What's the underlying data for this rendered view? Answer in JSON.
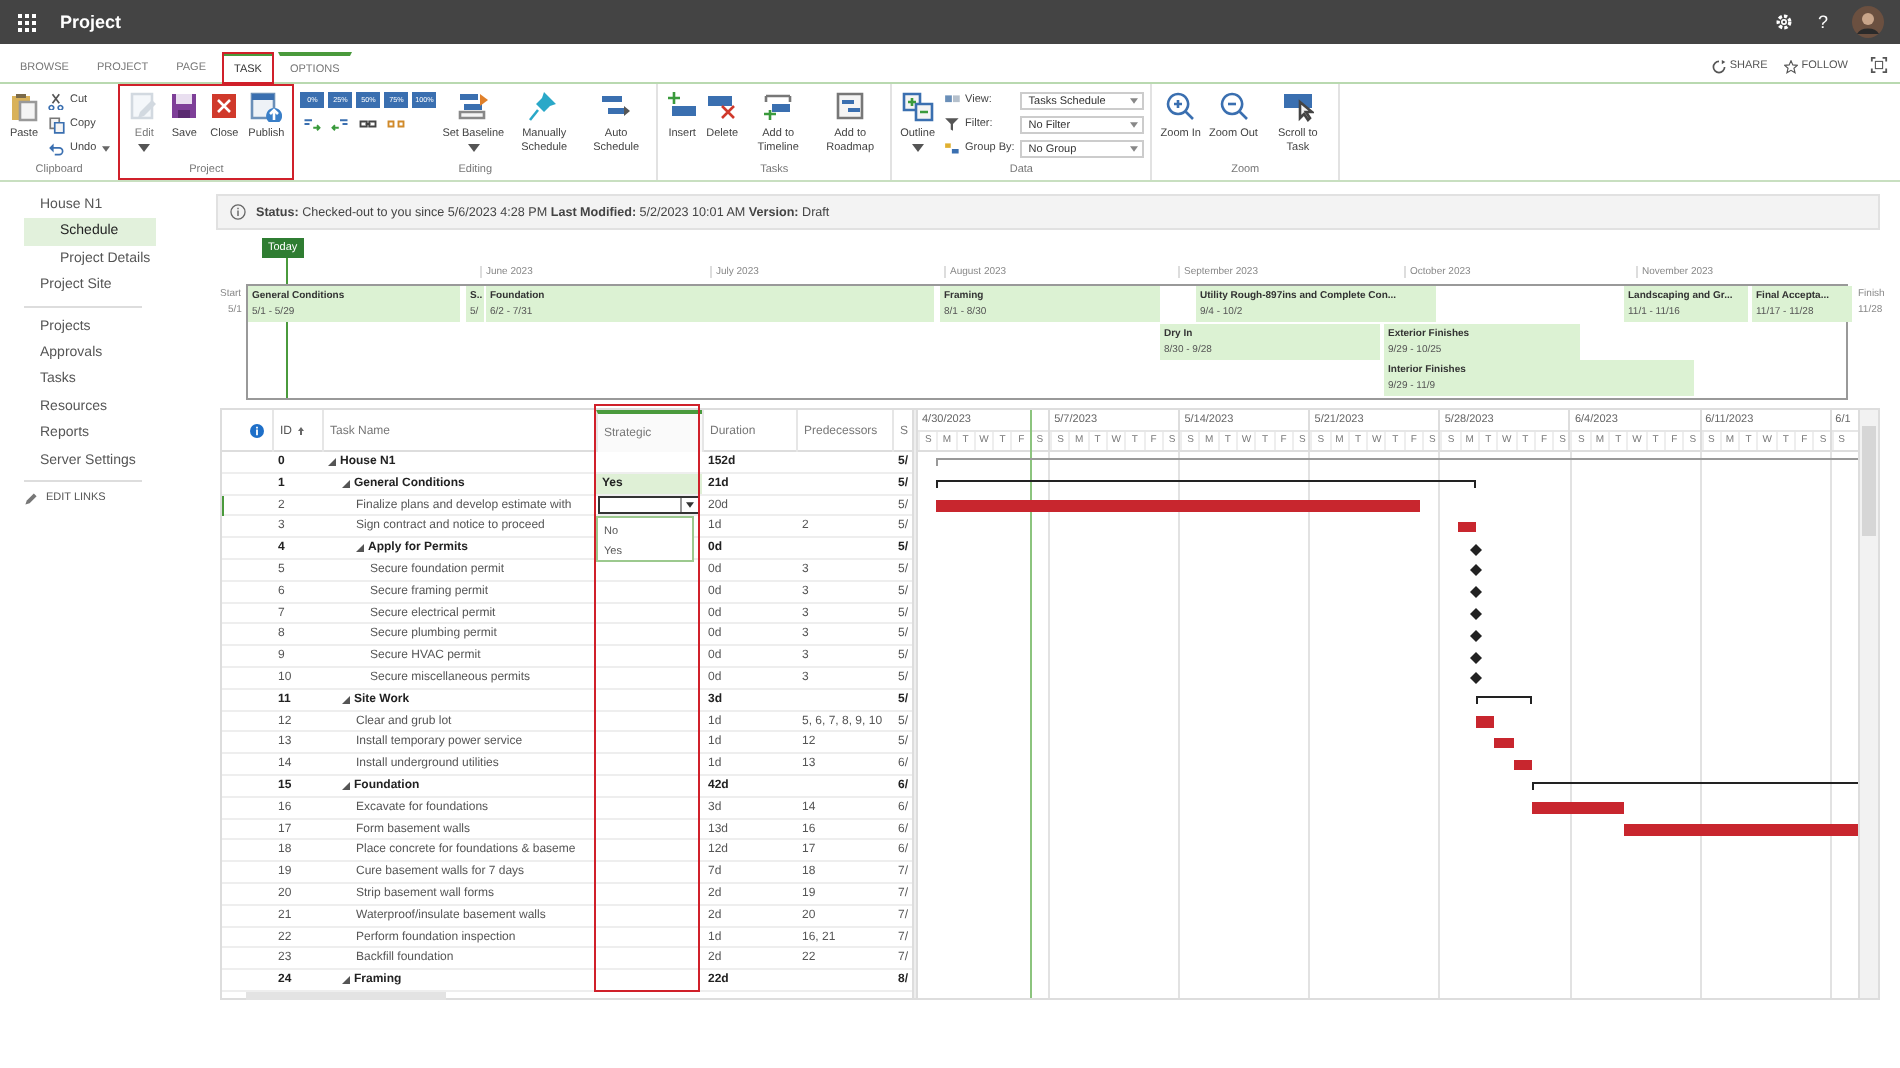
{
  "app": {
    "title": "Project",
    "help": "?"
  },
  "tabs": [
    {
      "label": "BROWSE",
      "selected": false,
      "highlighted": false,
      "contextual": false
    },
    {
      "label": "PROJECT",
      "selected": false,
      "highlighted": false,
      "contextual": false
    },
    {
      "label": "PAGE",
      "selected": false,
      "highlighted": false,
      "contextual": false
    },
    {
      "label": "TASK",
      "selected": true,
      "highlighted": true,
      "contextual": true
    },
    {
      "label": "OPTIONS",
      "selected": false,
      "highlighted": false,
      "contextual": true
    }
  ],
  "header_actions": [
    {
      "label": "SHARE"
    },
    {
      "label": "FOLLOW"
    }
  ],
  "ribbon": [
    {
      "label": "Clipboard",
      "highlighted": false,
      "buttons": [
        {
          "label": "Paste",
          "kind": "large",
          "disabled": false,
          "dropdown": false
        },
        {
          "label": "Cut",
          "kind": "small",
          "disabled": false,
          "dropdown": false
        },
        {
          "label": "Copy",
          "kind": "small",
          "disabled": false,
          "dropdown": false
        },
        {
          "label": "Undo",
          "kind": "small",
          "disabled": false,
          "dropdown": true
        }
      ]
    },
    {
      "label": "Project",
      "highlighted": true,
      "buttons": [
        {
          "label": "Edit",
          "kind": "large",
          "disabled": true,
          "dropdown": true
        },
        {
          "label": "Save",
          "kind": "large",
          "disabled": false,
          "dropdown": false
        },
        {
          "label": "Close",
          "kind": "large",
          "disabled": false,
          "dropdown": false
        },
        {
          "label": "Publish",
          "kind": "large",
          "disabled": false,
          "dropdown": false
        }
      ]
    },
    {
      "label": "Editing",
      "highlighted": false,
      "buttons": [
        {
          "label": "0%",
          "kind": "progress",
          "disabled": false,
          "dropdown": false
        },
        {
          "label": "25%",
          "kind": "progress",
          "disabled": false,
          "dropdown": false
        },
        {
          "label": "50%",
          "kind": "progress",
          "disabled": false,
          "dropdown": false
        },
        {
          "label": "75%",
          "kind": "progress",
          "disabled": false,
          "dropdown": false
        },
        {
          "label": "100%",
          "kind": "progress",
          "disabled": false,
          "dropdown": false
        },
        {
          "kind": "icon",
          "disabled": false,
          "dropdown": false
        },
        {
          "kind": "icon",
          "disabled": false,
          "dropdown": false
        },
        {
          "kind": "icon",
          "disabled": false,
          "dropdown": false
        },
        {
          "kind": "icon",
          "disabled": false,
          "dropdown": false
        },
        {
          "label": "Set Baseline",
          "kind": "large",
          "disabled": false,
          "dropdown": true
        },
        {
          "label": "Manually Schedule",
          "kind": "large",
          "disabled": false,
          "dropdown": false
        },
        {
          "label": "Auto Schedule",
          "kind": "large",
          "disabled": false,
          "dropdown": false
        }
      ]
    },
    {
      "label": "Tasks",
      "highlighted": false,
      "buttons": [
        {
          "label": "Insert",
          "kind": "large",
          "disabled": false,
          "dropdown": false
        },
        {
          "label": "Delete",
          "kind": "large",
          "disabled": false,
          "dropdown": false
        },
        {
          "label": "Add to Timeline",
          "kind": "large",
          "disabled": false,
          "dropdown": false
        },
        {
          "label": "Add to Roadmap",
          "kind": "large",
          "disabled": false,
          "dropdown": false
        }
      ]
    },
    {
      "label": "Data",
      "highlighted": false,
      "buttons": [
        {
          "label": "Outline",
          "kind": "large",
          "disabled": false,
          "dropdown": true
        },
        {
          "label": "View:",
          "kind": "small",
          "disabled": false,
          "dropdown": false
        },
        {
          "label": "Filter:",
          "kind": "small",
          "disabled": false,
          "dropdown": false
        },
        {
          "label": "Group By:",
          "kind": "small",
          "disabled": false,
          "dropdown": false
        },
        {
          "label": "Tasks Schedule",
          "kind": "select",
          "disabled": false,
          "dropdown": true
        },
        {
          "label": "No Filter",
          "kind": "select",
          "disabled": false,
          "dropdown": true
        },
        {
          "label": "No Group",
          "kind": "select",
          "disabled": false,
          "dropdown": true
        }
      ]
    },
    {
      "label": "Zoom",
      "highlighted": false,
      "buttons": [
        {
          "label": "Zoom In",
          "kind": "large",
          "disabled": false,
          "dropdown": false
        },
        {
          "label": "Zoom Out",
          "kind": "large",
          "disabled": false,
          "dropdown": false
        },
        {
          "label": "Scroll to Task",
          "kind": "large",
          "disabled": false,
          "dropdown": false
        }
      ]
    }
  ],
  "nav": {
    "items": [
      {
        "label": "House N1",
        "selected": false,
        "children": [
          {
            "label": "Schedule",
            "selected": true
          },
          {
            "label": "Project Details",
            "selected": false
          }
        ]
      },
      {
        "label": "Project Site",
        "selected": false
      }
    ],
    "links": [
      {
        "label": "Projects"
      },
      {
        "label": "Approvals"
      },
      {
        "label": "Tasks"
      },
      {
        "label": "Resources"
      },
      {
        "label": "Reports"
      },
      {
        "label": "Server Settings"
      }
    ],
    "edit_links": "EDIT LINKS"
  },
  "status": "**Status:** Checked-out to you since 5/6/2023 4:28 PM **Last Modified:** 5/2/2023 10:01 AM **Version:** Draft",
  "timeline": {
    "today": "Today",
    "start_label": "Start",
    "start_date": "5/1",
    "finish_label": "Finish",
    "finish_date": "11/28",
    "months": [
      "June 2023",
      "July 2023",
      "August 2023",
      "September 2023",
      "October 2023",
      "November 2023"
    ],
    "bars": [
      {
        "name": "General Conditions",
        "dates": "5/1 - 5/29"
      },
      {
        "name": "S..",
        "dates": "5/"
      },
      {
        "name": "Foundation",
        "dates": "6/2 - 7/31"
      },
      {
        "name": "Framing",
        "dates": "8/1 - 8/30"
      },
      {
        "name": "Utility Rough-897ins and Complete Con...",
        "dates": "9/4 - 10/2"
      },
      {
        "name": "Landscaping and Gr...",
        "dates": "11/1 - 11/16"
      },
      {
        "name": "Final Accepta...",
        "dates": "11/17 - 11/28"
      },
      {
        "name": "Dry In",
        "dates": "8/30 - 9/28"
      },
      {
        "name": "Exterior Finishes",
        "dates": "9/29 - 10/25"
      },
      {
        "name": "Interior Finishes",
        "dates": "9/29 - 11/9"
      }
    ]
  },
  "grid": {
    "columns": [
      {
        "label": "ID",
        "sorted": true,
        "selected": false,
        "highlighted": false
      },
      {
        "label": "Task Name",
        "sorted": false,
        "selected": false,
        "highlighted": false
      },
      {
        "label": "Strategic",
        "sorted": false,
        "selected": true,
        "highlighted": true
      },
      {
        "label": "Duration",
        "sorted": false,
        "selected": false,
        "highlighted": false
      },
      {
        "label": "Predecessors",
        "sorted": false,
        "selected": false,
        "highlighted": false
      },
      {
        "label": "S",
        "sorted": false,
        "selected": false,
        "highlighted": false
      }
    ],
    "dropdown_options": [
      {
        "label": "No",
        "selected": false
      },
      {
        "label": "Yes",
        "selected": false
      }
    ],
    "rows": [
      {
        "id": "0",
        "name": "House N1",
        "kind": "summary",
        "expanded": true,
        "selected": false,
        "editing": false,
        "duration": "152d",
        "start": "5/",
        "children": [
          {
            "id": "1",
            "name": "General Conditions",
            "kind": "summary",
            "expanded": true,
            "selected": true,
            "editing": false,
            "strategic": "Yes",
            "duration": "21d",
            "start": "5/",
            "children": [
              {
                "id": "2",
                "name": "Finalize plans and develop estimate with",
                "kind": "task",
                "expanded": false,
                "selected": false,
                "editing": true,
                "duration": "20d",
                "start": "5/"
              },
              {
                "id": "3",
                "name": "Sign contract and notice to proceed",
                "kind": "task",
                "expanded": false,
                "selected": false,
                "editing": false,
                "duration": "1d",
                "predecessors": "2",
                "start": "5/"
              },
              {
                "id": "4",
                "name": "Apply for Permits",
                "kind": "summary",
                "expanded": true,
                "selected": false,
                "editing": false,
                "duration": "0d",
                "start": "5/",
                "children": [
                  {
                    "id": "5",
                    "name": "Secure foundation permit",
                    "kind": "milestone",
                    "expanded": false,
                    "selected": false,
                    "editing": false,
                    "duration": "0d",
                    "predecessors": "3",
                    "start": "5/"
                  },
                  {
                    "id": "6",
                    "name": "Secure framing permit",
                    "kind": "milestone",
                    "expanded": false,
                    "selected": false,
                    "editing": false,
                    "duration": "0d",
                    "predecessors": "3",
                    "start": "5/"
                  },
                  {
                    "id": "7",
                    "name": "Secure electrical permit",
                    "kind": "milestone",
                    "expanded": false,
                    "selected": false,
                    "editing": false,
                    "duration": "0d",
                    "predecessors": "3",
                    "start": "5/"
                  },
                  {
                    "id": "8",
                    "name": "Secure plumbing permit",
                    "kind": "milestone",
                    "expanded": false,
                    "selected": false,
                    "editing": false,
                    "duration": "0d",
                    "predecessors": "3",
                    "start": "5/"
                  },
                  {
                    "id": "9",
                    "name": "Secure HVAC permit",
                    "kind": "milestone",
                    "expanded": false,
                    "selected": false,
                    "editing": false,
                    "duration": "0d",
                    "predecessors": "3",
                    "start": "5/"
                  },
                  {
                    "id": "10",
                    "name": "Secure miscellaneous permits",
                    "kind": "milestone",
                    "expanded": false,
                    "selected": false,
                    "editing": false,
                    "duration": "0d",
                    "predecessors": "3",
                    "start": "5/"
                  }
                ]
              }
            ]
          },
          {
            "id": "11",
            "name": "Site Work",
            "kind": "summary",
            "expanded": true,
            "selected": false,
            "editing": false,
            "duration": "3d",
            "start": "5/",
            "children": [
              {
                "id": "12",
                "name": "Clear and grub lot",
                "kind": "task",
                "expanded": false,
                "selected": false,
                "editing": false,
                "duration": "1d",
                "predecessors": "5, 6, 7, 8, 9, 10",
                "start": "5/"
              },
              {
                "id": "13",
                "name": "Install temporary power service",
                "kind": "task",
                "expanded": false,
                "selected": false,
                "editing": false,
                "duration": "1d",
                "predecessors": "12",
                "start": "5/"
              },
              {
                "id": "14",
                "name": "Install underground utilities",
                "kind": "task",
                "expanded": false,
                "selected": false,
                "editing": false,
                "duration": "1d",
                "predecessors": "13",
                "start": "6/"
              }
            ]
          },
          {
            "id": "15",
            "name": "Foundation",
            "kind": "summary",
            "expanded": true,
            "selected": false,
            "editing": false,
            "duration": "42d",
            "start": "6/",
            "children": [
              {
                "id": "16",
                "name": "Excavate for foundations",
                "kind": "task",
                "expanded": false,
                "selected": false,
                "editing": false,
                "duration": "3d",
                "predecessors": "14",
                "start": "6/"
              },
              {
                "id": "17",
                "name": "Form basement walls",
                "kind": "task",
                "expanded": false,
                "selected": false,
                "editing": false,
                "duration": "13d",
                "predecessors": "16",
                "start": "6/"
              },
              {
                "id": "18",
                "name": "Place concrete for foundations & baseme",
                "kind": "task",
                "expanded": false,
                "selected": false,
                "editing": false,
                "duration": "12d",
                "predecessors": "17",
                "start": "6/"
              },
              {
                "id": "19",
                "name": "Cure basement walls for 7 days",
                "kind": "task",
                "expanded": false,
                "selected": false,
                "editing": false,
                "duration": "7d",
                "predecessors": "18",
                "start": "7/"
              },
              {
                "id": "20",
                "name": "Strip basement wall forms",
                "kind": "task",
                "expanded": false,
                "selected": false,
                "editing": false,
                "duration": "2d",
                "predecessors": "19",
                "start": "7/"
              },
              {
                "id": "21",
                "name": "Waterproof/insulate basement walls",
                "kind": "task",
                "expanded": false,
                "selected": false,
                "editing": false,
                "duration": "2d",
                "predecessors": "20",
                "start": "7/"
              },
              {
                "id": "22",
                "name": "Perform foundation inspection",
                "kind": "task",
                "expanded": false,
                "selected": false,
                "editing": false,
                "duration": "1d",
                "predecessors": "16, 21",
                "start": "7/"
              },
              {
                "id": "23",
                "name": "Backfill foundation",
                "kind": "task",
                "expanded": false,
                "selected": false,
                "editing": false,
                "duration": "2d",
                "predecessors": "22",
                "start": "7/"
              }
            ]
          },
          {
            "id": "24",
            "name": "Framing",
            "kind": "summary",
            "expanded": true,
            "selected": false,
            "editing": false,
            "duration": "22d",
            "start": "8/"
          }
        ]
      }
    ]
  },
  "gantt": {
    "weeks": [
      {
        "date": "4/30/2023",
        "days": [
          "S",
          "M",
          "T",
          "W",
          "T",
          "F",
          "S"
        ]
      },
      {
        "date": "5/7/2023",
        "days": [
          "S",
          "M",
          "T",
          "W",
          "T",
          "F",
          "S"
        ]
      },
      {
        "date": "5/14/2023",
        "days": [
          "S",
          "M",
          "T",
          "W",
          "T",
          "F",
          "S"
        ]
      },
      {
        "date": "5/21/2023",
        "days": [
          "S",
          "M",
          "T",
          "W",
          "T",
          "F",
          "S"
        ]
      },
      {
        "date": "5/28/2023",
        "days": [
          "S",
          "M",
          "T",
          "W",
          "T",
          "F",
          "S"
        ]
      },
      {
        "date": "6/4/2023",
        "days": [
          "S",
          "M",
          "T",
          "W",
          "T",
          "F",
          "S"
        ]
      },
      {
        "date": "6/11/2023",
        "days": [
          "S",
          "M",
          "T",
          "W",
          "T",
          "F",
          "S"
        ]
      },
      {
        "date": "6/1",
        "days": [
          "S"
        ]
      }
    ]
  }
}
